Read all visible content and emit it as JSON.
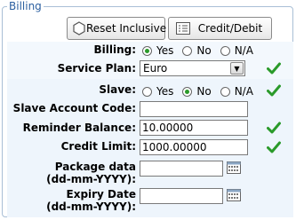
{
  "section": {
    "legend": "Billing"
  },
  "buttons": {
    "reset_inclusive": "Reset Inclusive",
    "credit_debit": "Credit/Debit"
  },
  "fields": {
    "billing": {
      "label": "Billing:",
      "options": [
        "Yes",
        "No",
        "N/A"
      ],
      "selected": "Yes"
    },
    "service_plan": {
      "label": "Service Plan:",
      "value": "Euro"
    },
    "slave": {
      "label": "Slave:",
      "options": [
        "Yes",
        "No",
        "N/A"
      ],
      "selected": "No"
    },
    "slave_account_code": {
      "label": "Slave Account Code:",
      "value": ""
    },
    "reminder_balance": {
      "label": "Reminder Balance:",
      "value": "10.00000"
    },
    "credit_limit": {
      "label": "Credit Limit:",
      "value": "1000.00000"
    },
    "package_data": {
      "label_line1": "Package data",
      "label_line2": "(dd-mm-YYYY):",
      "value": ""
    },
    "expiry_date": {
      "label_line1": "Expiry Date",
      "label_line2": "(dd-mm-YYYY):",
      "value": ""
    }
  },
  "colors": {
    "legend": "#2b5fa0",
    "check": "#2a9a2a",
    "band": "#eef5fc"
  }
}
